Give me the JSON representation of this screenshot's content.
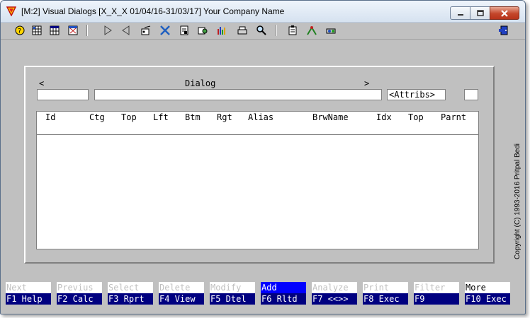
{
  "window": {
    "title": "[M:2]  Visual Dialogs  [X_X_X  01/04/16-31/03/17]  Your Company Name"
  },
  "dialog": {
    "left_arrow": "<",
    "label": "Dialog",
    "right_arrow": ">",
    "attribs_button": "<Attribs>"
  },
  "table": {
    "columns": [
      "Id",
      "Ctg",
      "Top",
      "Lft",
      "Btm",
      "Rgt",
      "Alias",
      "BrwName",
      "Idx",
      "Top",
      "Parnt"
    ]
  },
  "fkeys": {
    "top": [
      "Next",
      "Previus",
      "Select",
      "Delete",
      "Modify",
      "Add",
      "Analyze",
      "Print",
      "Filter",
      "More"
    ],
    "bottom": [
      "F1 Help",
      "F2 Calc",
      "F3 Rprt",
      "F4 View",
      "F5 Dtel",
      "F6 Rltd",
      "F7 <<>>",
      "F8 Exec",
      "F9",
      "F10 Exec"
    ]
  },
  "copyright": "Copyright  (C)  1993-2016  Pritpal Bedi",
  "colors": {
    "fkey_bottom_bg": "#000080",
    "fkey_active_bg": "#0000ff",
    "window_bg": "#c0c0c0"
  },
  "icons": {
    "app": "v-shaped-app-icon",
    "minimize": "minimize-icon",
    "maximize": "maximize-icon",
    "close": "close-icon"
  }
}
